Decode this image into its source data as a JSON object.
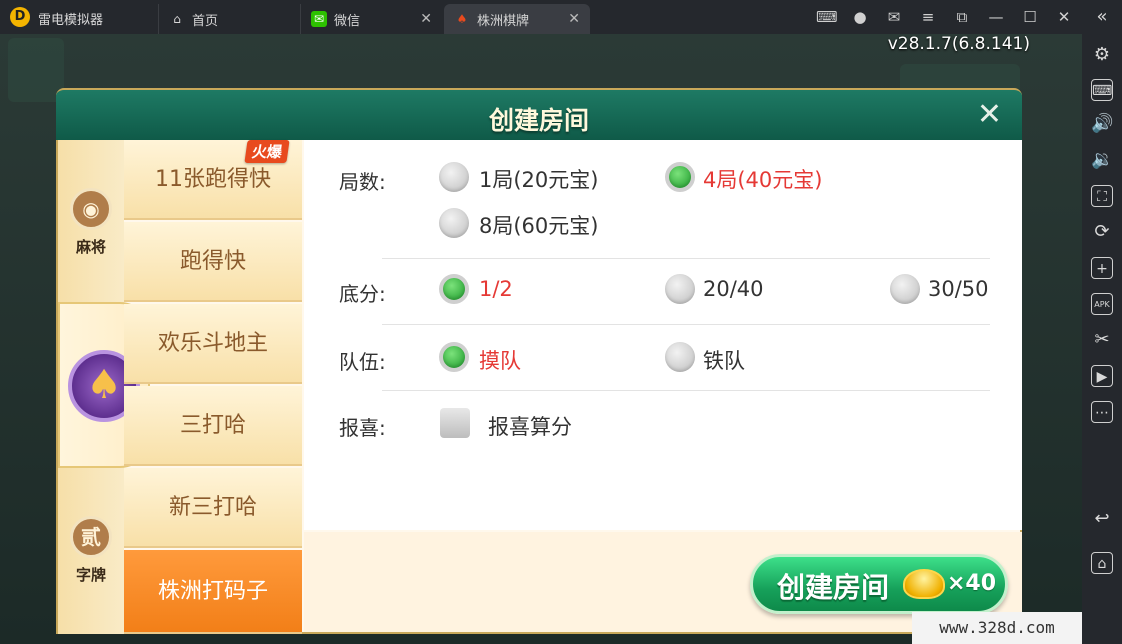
{
  "titlebar": {
    "app_name": "雷电模拟器",
    "tabs": [
      {
        "label": "首页",
        "icon": "home-icon"
      },
      {
        "label": "微信",
        "icon": "wechat-icon"
      },
      {
        "label": "株洲棋牌",
        "icon": "game-icon"
      }
    ]
  },
  "game": {
    "version": "v28.1.7(6.8.141)",
    "watermark": "www.328d.com"
  },
  "dialog": {
    "title": "创建房间",
    "categories": [
      {
        "label": "麻将",
        "glyph": "◉"
      },
      {
        "label": "",
        "glyph": "♠"
      },
      {
        "label": "字牌",
        "glyph": "贰"
      }
    ],
    "modes": [
      {
        "label": "11张跑得快",
        "selected": false
      },
      {
        "label": "跑得快",
        "selected": false
      },
      {
        "label": "欢乐斗地主",
        "selected": false
      },
      {
        "label": "三打哈",
        "selected": false
      },
      {
        "label": "新三打哈",
        "selected": false
      },
      {
        "label": "株洲打码子",
        "selected": true
      }
    ],
    "hot_badge": "火爆",
    "options": {
      "rounds": {
        "label": "局数:",
        "choices": [
          {
            "text": "1局(20元宝)",
            "checked": false
          },
          {
            "text": "4局(40元宝)",
            "checked": true
          },
          {
            "text": "8局(60元宝)",
            "checked": false
          }
        ]
      },
      "base": {
        "label": "底分:",
        "choices": [
          {
            "text": "1/2",
            "checked": true
          },
          {
            "text": "20/40",
            "checked": false
          },
          {
            "text": "30/50",
            "checked": false
          }
        ]
      },
      "team": {
        "label": "队伍:",
        "choices": [
          {
            "text": "摸队",
            "checked": true
          },
          {
            "text": "铁队",
            "checked": false
          }
        ]
      },
      "announce": {
        "label": "报喜:",
        "checkbox": {
          "text": "报喜算分",
          "checked": false
        }
      }
    },
    "create_button": {
      "label": "创建房间",
      "cost": "×40"
    }
  }
}
